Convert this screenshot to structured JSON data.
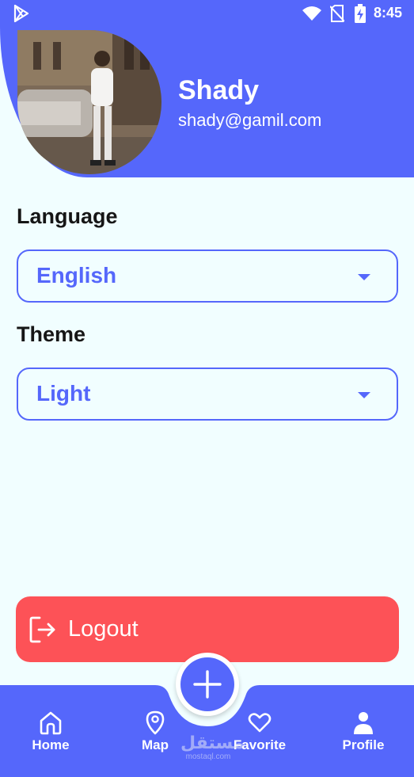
{
  "status_bar": {
    "time": "8:45",
    "icons": [
      "play-store-icon",
      "wifi-icon",
      "no-sim-icon",
      "battery-charging-icon"
    ]
  },
  "profile": {
    "name": "Shady",
    "email": "shady@gamil.com",
    "avatar": "profile-photo"
  },
  "settings": {
    "language_label": "Language",
    "language_value": "English",
    "theme_label": "Theme",
    "theme_value": "Light"
  },
  "logout": {
    "label": "Logout",
    "icon": "logout-icon"
  },
  "bottom_nav": {
    "items": [
      {
        "label": "Home",
        "icon": "home-icon"
      },
      {
        "label": "Map",
        "icon": "map-pin-icon"
      },
      {
        "label": "Favorite",
        "icon": "heart-icon"
      },
      {
        "label": "Profile",
        "icon": "person-icon"
      }
    ],
    "fab_icon": "plus-icon"
  },
  "watermark": {
    "main": "مستقل",
    "sub": "mostaql.com"
  },
  "colors": {
    "primary": "#5567fb",
    "background": "#f1feff",
    "danger": "#fd5257",
    "text": "#161616"
  }
}
